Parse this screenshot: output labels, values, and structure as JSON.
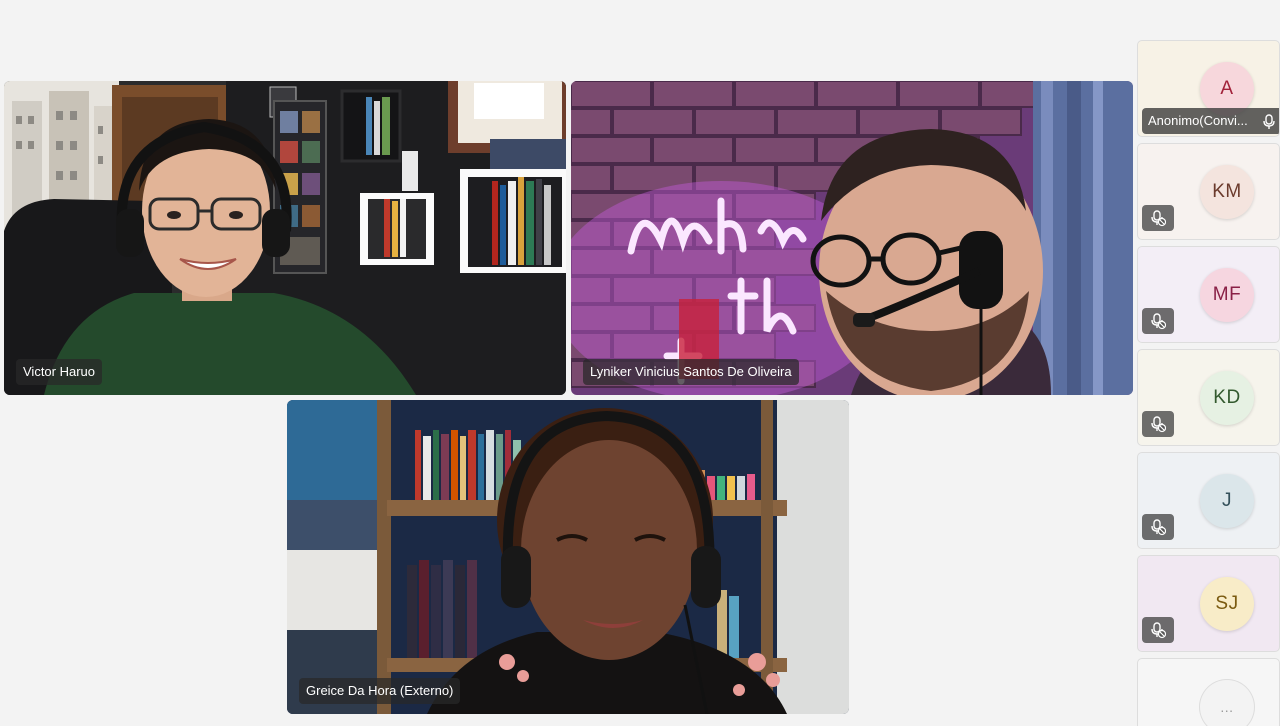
{
  "participants": {
    "victor": {
      "name": "Victor Haruo"
    },
    "lyniker": {
      "name": "Lyniker Vinicius Santos De Oliveira"
    },
    "greice": {
      "name": "Greice Da Hora (Externo)"
    }
  },
  "side_panel": {
    "items": [
      {
        "initials": "A",
        "label": "Anonimo(Convi...",
        "avatar_color": "#f7d7dc",
        "text_color": "#a2223a",
        "bg": "#f7f2e6"
      },
      {
        "initials": "KM",
        "avatar_color": "#f4e4de",
        "text_color": "#6b3a2c",
        "bg": "#f7f2ef"
      },
      {
        "initials": "MF",
        "avatar_color": "#f6d6e0",
        "text_color": "#8a2046",
        "bg": "#f3eef6"
      },
      {
        "initials": "KD",
        "avatar_color": "#e6f1e3",
        "text_color": "#335a2e",
        "bg": "#f6f4ec"
      },
      {
        "initials": "J",
        "avatar_color": "#dbe6ea",
        "text_color": "#33505a",
        "bg": "#eef1f4"
      },
      {
        "initials": "SJ",
        "avatar_color": "#f8ecc8",
        "text_color": "#7a5a10",
        "bg": "#f1e8f2"
      },
      {
        "initials": "...",
        "avatar_color": "#f3f3f3",
        "text_color": "#999999",
        "bg": "#f6f6f6"
      }
    ]
  },
  "icons": {
    "mic": "mic-icon",
    "mic_muted": "mic-muted-icon"
  }
}
